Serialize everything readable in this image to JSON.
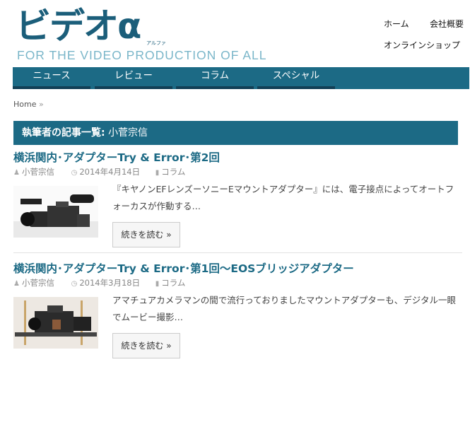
{
  "site": {
    "logo_text": "ビデオα",
    "logo_ruby": "アルファ",
    "tagline": "FOR THE VIDEO PRODUCTION OF ALL"
  },
  "top_links": {
    "home": "ホーム",
    "company": "会社概要",
    "shop": "オンラインショップ"
  },
  "nav": {
    "news": "ニュース",
    "review": "レビュー",
    "column": "コラム",
    "special": "スペシャル"
  },
  "breadcrumb": {
    "home": "Home",
    "sep": "»"
  },
  "author_header": {
    "label": "執筆者の記事一覧:",
    "name": "小菅宗信"
  },
  "posts": [
    {
      "title": "横浜関内･アダプターTry & Error･第2回",
      "author": "小菅宗信",
      "date": "2014年4月14日",
      "category": "コラム",
      "excerpt": "『キヤノンEFレンズーソニーEマウントアダプター』には、電子接点によってオートフォーカスが作動する…",
      "more": "続きを読む »"
    },
    {
      "title": "横浜関内･アダプターTry & Error･第1回～EOSブリッジアダプター",
      "author": "小菅宗信",
      "date": "2014年3月18日",
      "category": "コラム",
      "excerpt": "アマチュアカメラマンの間で流行っておりましたマウントアダプターも、デジタル一眼でムービー撮影…",
      "more": "続きを読む »"
    }
  ],
  "colors": {
    "brand": "#1c6a85",
    "brand_dark": "#123f55",
    "tagline": "#7ab6c9"
  }
}
